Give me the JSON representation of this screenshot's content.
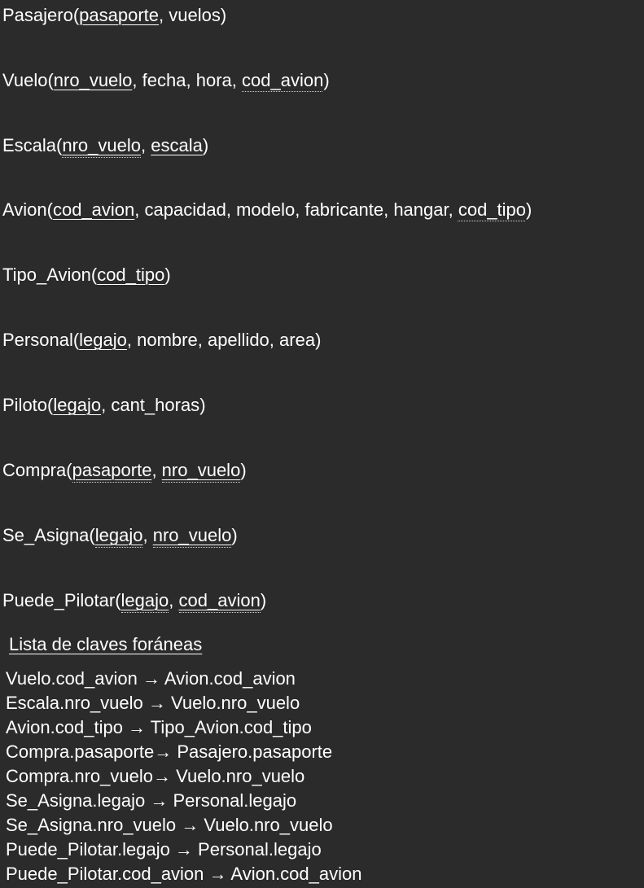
{
  "relations": [
    {
      "name": "Pasajero",
      "attrs": [
        {
          "text": "pasaporte",
          "kind": "pk"
        },
        {
          "text": "vuelos",
          "kind": "plain"
        }
      ]
    },
    {
      "name": "Vuelo",
      "attrs": [
        {
          "text": "nro_vuelo",
          "kind": "pk"
        },
        {
          "text": "fecha",
          "kind": "plain"
        },
        {
          "text": "hora",
          "kind": "plain"
        },
        {
          "text": "cod_avion",
          "kind": "fk"
        }
      ]
    },
    {
      "name": "Escala",
      "attrs": [
        {
          "text": "nro_vuelo",
          "kind": "pkfk"
        },
        {
          "text": "escala",
          "kind": "pk"
        }
      ]
    },
    {
      "name": "Avion",
      "attrs": [
        {
          "text": "cod_avion",
          "kind": "pk"
        },
        {
          "text": "capacidad",
          "kind": "plain"
        },
        {
          "text": "modelo",
          "kind": "plain"
        },
        {
          "text": "fabricante",
          "kind": "plain"
        },
        {
          "text": "hangar",
          "kind": "plain"
        },
        {
          "text": "cod_tipo",
          "kind": "fk"
        }
      ]
    },
    {
      "name": "Tipo_Avion",
      "attrs": [
        {
          "text": "cod_tipo",
          "kind": "pk"
        }
      ]
    },
    {
      "name": "Personal",
      "attrs": [
        {
          "text": "legajo",
          "kind": "pk"
        },
        {
          "text": "nombre",
          "kind": "plain"
        },
        {
          "text": "apellido",
          "kind": "plain"
        },
        {
          "text": "area",
          "kind": "plain"
        }
      ]
    },
    {
      "name": "Piloto",
      "attrs": [
        {
          "text": "legajo",
          "kind": "pk"
        },
        {
          "text": "cant_horas",
          "kind": "plain"
        }
      ]
    },
    {
      "name": "Compra",
      "attrs": [
        {
          "text": "pasaporte",
          "kind": "pkfk"
        },
        {
          "text": "nro_vuelo",
          "kind": "pkfk"
        }
      ]
    },
    {
      "name": "Se_Asigna",
      "attrs": [
        {
          "text": "legajo",
          "kind": "pkfk"
        },
        {
          "text": "nro_vuelo",
          "kind": "pkfk"
        }
      ]
    },
    {
      "name": "Puede_Pilotar",
      "attrs": [
        {
          "text": "legajo",
          "kind": "pkfk"
        },
        {
          "text": "cod_avion",
          "kind": "pkfk"
        }
      ]
    }
  ],
  "foreign_keys": {
    "title": "Lista de claves foráneas",
    "items": [
      "Vuelo.cod_avion → Avion.cod_avion",
      "Escala.nro_vuelo → Vuelo.nro_vuelo",
      "Avion.cod_tipo → Tipo_Avion.cod_tipo",
      "Compra.pasaporte→ Pasajero.pasaporte",
      "Compra.nro_vuelo→ Vuelo.nro_vuelo",
      "Se_Asigna.legajo → Personal.legajo",
      "Se_Asigna.nro_vuelo → Vuelo.nro_vuelo",
      "Puede_Pilotar.legajo → Personal.legajo",
      "Puede_Pilotar.cod_avion → Avion.cod_avion"
    ]
  }
}
